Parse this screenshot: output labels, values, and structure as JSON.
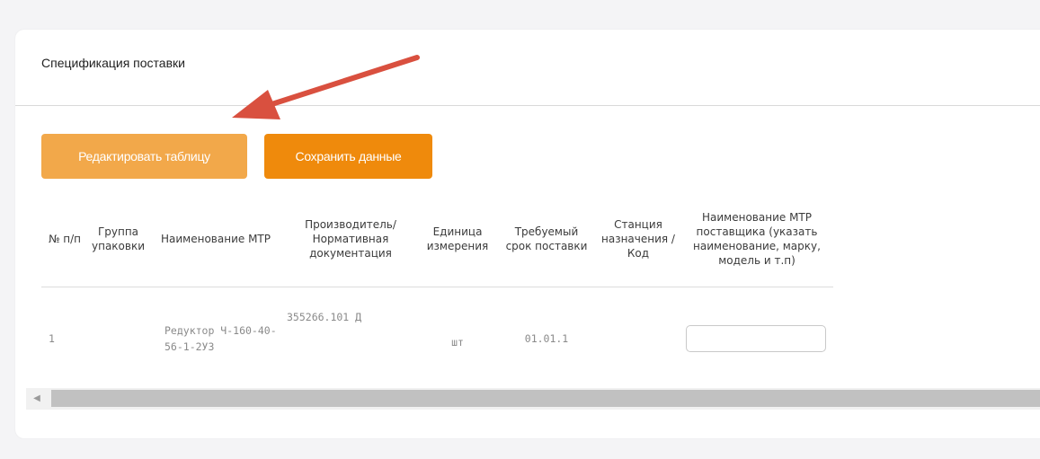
{
  "section": {
    "title": "Спецификация поставки"
  },
  "toolbar": {
    "edit_label": "Редактировать таблицу",
    "save_label": "Сохранить данные"
  },
  "table": {
    "headers": [
      "№ п/п",
      "Группа упаковки",
      "Наименование МТР",
      "Производитель/ Нормативная документация",
      "Единица измерения",
      "Требуемый срок поставки",
      "Станция назначения / Код",
      "Наименование МТР поставщика (указать наименование, марку, модель и т.п)"
    ],
    "rows": [
      {
        "num": "1",
        "group": "",
        "name": "Редуктор Ч-160-40-56-1-2У3",
        "maker": "355266.101 Д",
        "unit": "шт",
        "term": "01.01.1",
        "station": "",
        "supplier_name": ""
      }
    ]
  },
  "colors": {
    "edit_button": "#f2a84a",
    "save_button": "#ef8a0c",
    "annotation_arrow": "#d9503f"
  },
  "icons": {
    "scroll_left": "chevron-left-icon",
    "annotation": "red-arrow-icon"
  }
}
